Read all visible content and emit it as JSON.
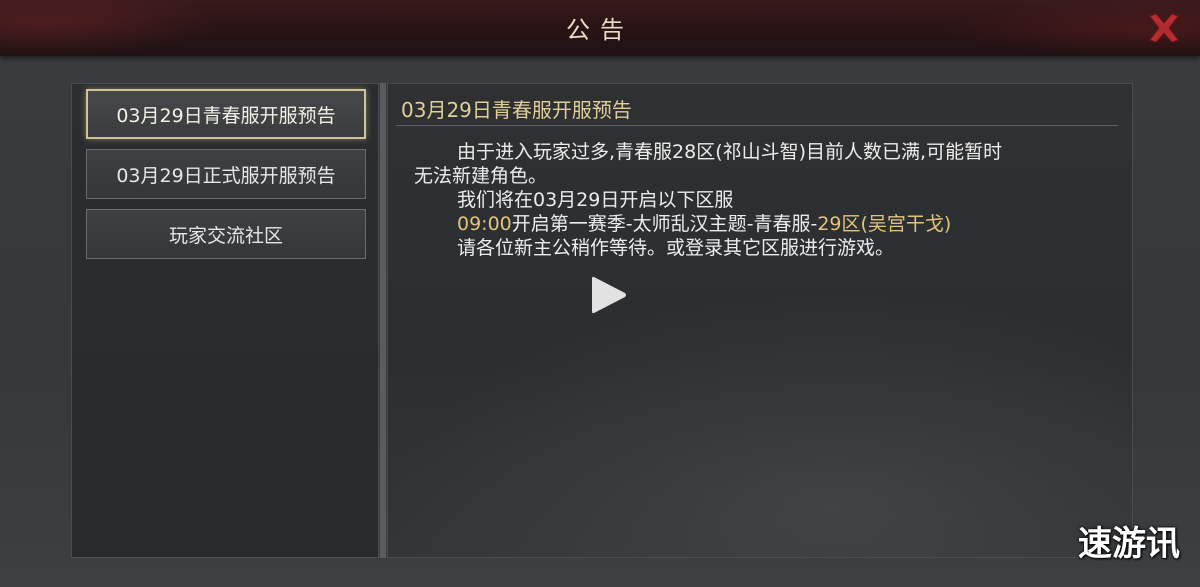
{
  "header": {
    "title": "公告"
  },
  "tabs": [
    {
      "label": "03月29日青春服开服预告",
      "active": true
    },
    {
      "label": "03月29日正式服开服预告",
      "active": false
    },
    {
      "label": "玩家交流社区",
      "active": false
    }
  ],
  "article": {
    "title": "03月29日青春服开服预告",
    "line1": "由于进入玩家过多,青春服28区(祁山斗智)目前人数已满,可能暂时",
    "line2": "无法新建角色。",
    "line3": "我们将在03月29日开启以下区服",
    "line4_time": "09:00",
    "line4_mid": "开启第一赛季-太师乱汉主题-青春服-",
    "line4_server": "29区(吴宫干戈)",
    "line5": "请各位新主公稍作等待。或登录其它区服进行游戏。"
  },
  "watermark": "速游讯",
  "icons": {
    "close": "close-icon",
    "play": "play-icon"
  },
  "colors": {
    "accent_gold": "#e0cf9a",
    "highlight": "#e3c27d",
    "close_red": "#d8343a"
  }
}
